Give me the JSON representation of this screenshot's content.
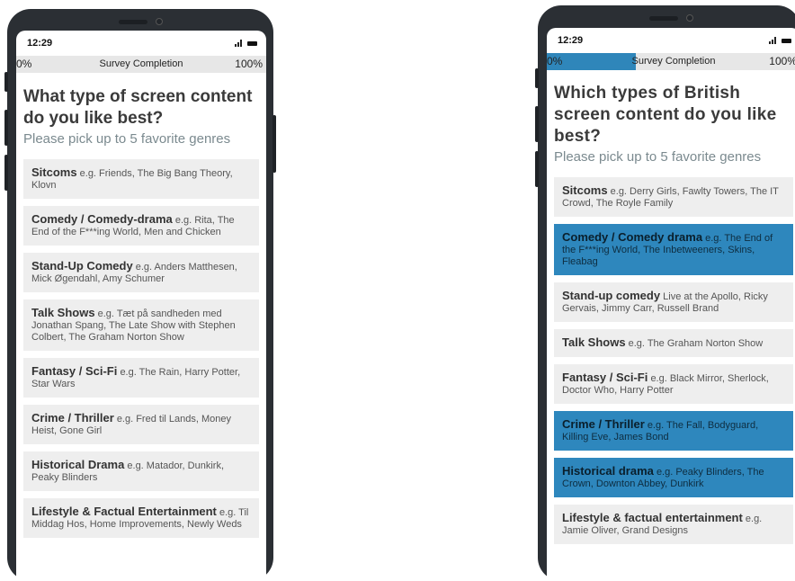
{
  "left_phone": {
    "status": {
      "time": "12:29"
    },
    "progress": {
      "start": "0%",
      "title": "Survey Completion",
      "end": "100%",
      "value": 0.0
    },
    "question": "What type of screen content do you like best?",
    "hint": "Please pick up to 5 favorite genres",
    "options": [
      {
        "label": "Sitcoms",
        "examples": "e.g. Friends, The Big Bang Theory, Klovn",
        "selected": false
      },
      {
        "label": "Comedy / Comedy-drama",
        "examples": "e.g. Rita, The End of the F***ing World, Men and Chicken",
        "selected": false
      },
      {
        "label": "Stand-Up Comedy",
        "examples": "e.g. Anders Matthesen, Mick Øgendahl, Amy Schumer",
        "selected": false
      },
      {
        "label": "Talk Shows",
        "examples": "e.g. Tæt på sandheden med Jonathan Spang, The Late Show with Stephen Colbert, The Graham Norton Show",
        "selected": false
      },
      {
        "label": "Fantasy / Sci-Fi",
        "examples": "e.g. The Rain, Harry Potter, Star Wars",
        "selected": false
      },
      {
        "label": "Crime / Thriller",
        "examples": "e.g. Fred til Lands, Money Heist, Gone Girl",
        "selected": false
      },
      {
        "label": "Historical Drama",
        "examples": "e.g. Matador, Dunkirk, Peaky Blinders",
        "selected": false
      },
      {
        "label": "Lifestyle & Factual Entertainment",
        "examples": "e.g. Til Middag Hos, Home Improvements, Newly Weds",
        "selected": false
      }
    ]
  },
  "right_phone": {
    "status": {
      "time": "12:29"
    },
    "progress": {
      "start": "0%",
      "title": "Survey Completion",
      "end": "100%",
      "value": 0.35
    },
    "question": "Which types of British screen content do you like best?",
    "hint": "Please pick up to 5 favorite genres",
    "options": [
      {
        "label": "Sitcoms",
        "examples": "e.g. Derry Girls, Fawlty Towers, The IT Crowd, The Royle Family",
        "selected": false
      },
      {
        "label": "Comedy / Comedy drama",
        "examples": "e.g. The End of the F***ing World, The Inbetweeners, Skins, Fleabag",
        "selected": true
      },
      {
        "label": "Stand-up comedy",
        "examples": "Live at the Apollo, Ricky Gervais, Jimmy Carr, Russell Brand",
        "selected": false
      },
      {
        "label": "Talk Shows",
        "examples": "e.g. The Graham Norton Show",
        "selected": false
      },
      {
        "label": "Fantasy / Sci-Fi",
        "examples": "e.g. Black Mirror, Sherlock, Doctor Who, Harry Potter",
        "selected": false
      },
      {
        "label": "Crime / Thriller",
        "examples": "e.g. The Fall, Bodyguard, Killing Eve, James Bond",
        "selected": true
      },
      {
        "label": "Historical drama",
        "examples": "e.g. Peaky Blinders, The Crown, Downton Abbey, Dunkirk",
        "selected": true
      },
      {
        "label": "Lifestyle & factual entertainment",
        "examples": "e.g. Jamie Oliver, Grand Designs",
        "selected": false
      }
    ]
  },
  "colors": {
    "accent": "#2e87bd",
    "option_bg": "#eeeeee",
    "phone_frame": "#2b2f34"
  },
  "icons": {
    "signal": "signal-icon",
    "battery": "battery-icon"
  }
}
